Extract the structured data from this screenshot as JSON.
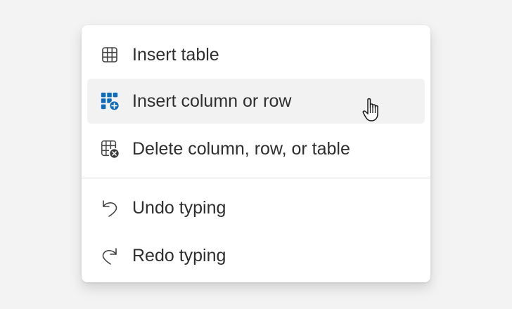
{
  "menu": {
    "items": [
      {
        "label": "Insert table",
        "icon": "table-icon"
      },
      {
        "label": "Insert column or row",
        "icon": "table-insert-icon",
        "state": "hover"
      },
      {
        "label": "Delete column, row, or table",
        "icon": "table-delete-icon"
      },
      {
        "label": "Undo typing",
        "icon": "undo-icon"
      },
      {
        "label": "Redo typing",
        "icon": "redo-icon"
      }
    ]
  },
  "colors": {
    "accent": "#0f6cbd",
    "hover_background": "#f2f2f2",
    "text": "#2f2f2f",
    "icon": "#424242",
    "delete_badge": "#3b3b3b"
  }
}
